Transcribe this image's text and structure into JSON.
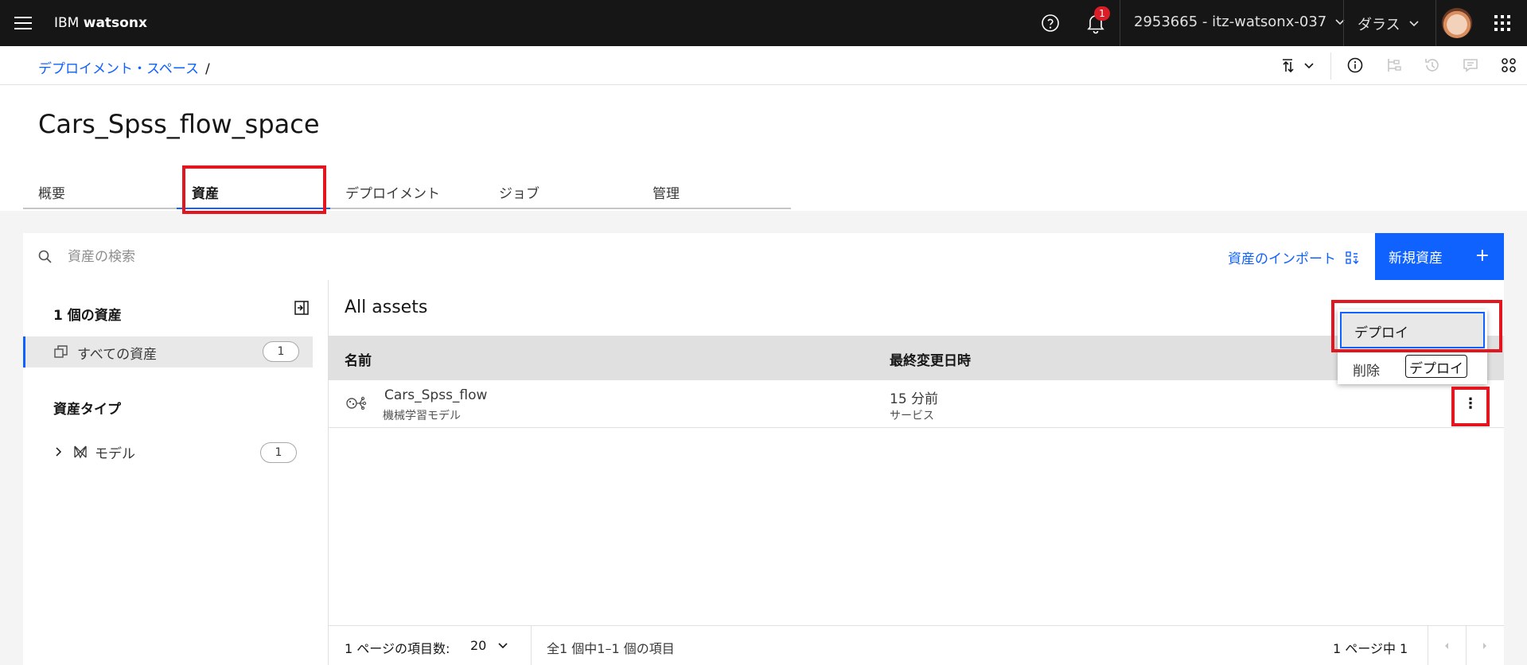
{
  "app": {
    "brand_prefix": "IBM ",
    "brand_name": "watsonx",
    "notification_count": "1",
    "account": "2953665 - itz-watsonx-037",
    "region": "ダラス"
  },
  "breadcrumb": {
    "link": "デプロイメント・スペース",
    "separator": "/"
  },
  "page": {
    "title": "Cars_Spss_flow_space"
  },
  "tabs": [
    {
      "label": "概要"
    },
    {
      "label": "資産"
    },
    {
      "label": "デプロイメント"
    },
    {
      "label": "ジョブ"
    },
    {
      "label": "管理"
    }
  ],
  "active_tab": "資産",
  "toolbar": {
    "search_placeholder": "資産の検索",
    "import_label": "資産のインポート",
    "new_asset_label": "新規資産"
  },
  "sidebar": {
    "count_title": "1 個の資産",
    "all_assets_label": "すべての資産",
    "all_assets_count": "1",
    "types_title": "資産タイプ",
    "types": [
      {
        "label": "モデル",
        "count": "1"
      }
    ]
  },
  "main": {
    "title": "All assets",
    "columns": [
      "名前",
      "最終変更日時"
    ],
    "rows": [
      {
        "name": "Cars_Spss_flow",
        "type": "機械学習モデル",
        "modified": "15 分前",
        "modified_by": "サービス"
      }
    ]
  },
  "pagination": {
    "per_page_label": "1 ページの項目数:",
    "per_page_value": "20",
    "range": "全1 個中1–1 個の項目",
    "pages": "1 ページ中 1"
  },
  "context_menu": {
    "deploy": "デプロイ",
    "delete": "削除",
    "tooltip": "デプロイ"
  },
  "colors": {
    "accent": "#0f62fe",
    "topbar": "#161616",
    "annotation": "#e3151f",
    "badge": "#da1e28"
  }
}
